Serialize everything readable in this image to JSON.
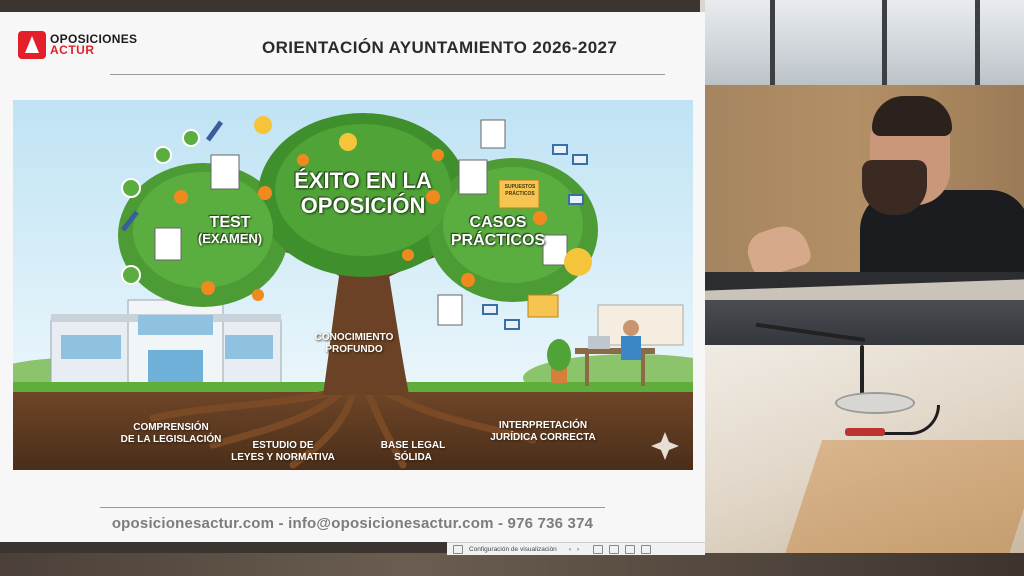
{
  "slide": {
    "logo_line1": "OPOSICIONES",
    "logo_line2": "ACTUR",
    "title": "ORIENTACIÓN AYUNTAMIENTO 2026-2027",
    "footer": "oposicionesactur.com - info@oposicionesactur.com -  976 736 374"
  },
  "illustration": {
    "center_title_line1": "ÉXITO EN LA",
    "center_title_line2": "OPOSICIÓN",
    "left_branch_line1": "TEST",
    "left_branch_line2": "(EXAMEN)",
    "right_branch_line1": "CASOS",
    "right_branch_line2": "PRÁCTICOS",
    "folder_label_line1": "SUPUESTOS",
    "folder_label_line2": "PRÁCTICOS",
    "trunk_line1": "CONOCIMIENTO",
    "trunk_line2": "PROFUNDO",
    "root1_line1": "COMPRENSIÓN",
    "root1_line2": "DE LA LEGISLACIÓN",
    "root2_line1": "ESTUDIO DE",
    "root2_line2": "LEYES Y NORMATIVA",
    "root3_line1": "BASE LEGAL",
    "root3_line2": "SÓLIDA",
    "root4_line1": "INTERPRETACIÓN",
    "root4_line2": "JURÍDICA CORRECTA"
  },
  "statusbar": {
    "label": "Configuración de visualización"
  },
  "colors": {
    "brand_red": "#e3202a",
    "sky": "#cde8f5",
    "canopy": "#3f8f2c",
    "trunk": "#6b4225",
    "soil": "#5a3a22"
  },
  "icons": [
    "logo-mark-icon",
    "sparkle-icon",
    "previous-icon",
    "next-icon",
    "view-normal-icon",
    "view-sorter-icon",
    "view-reading-icon",
    "view-slideshow-icon"
  ]
}
